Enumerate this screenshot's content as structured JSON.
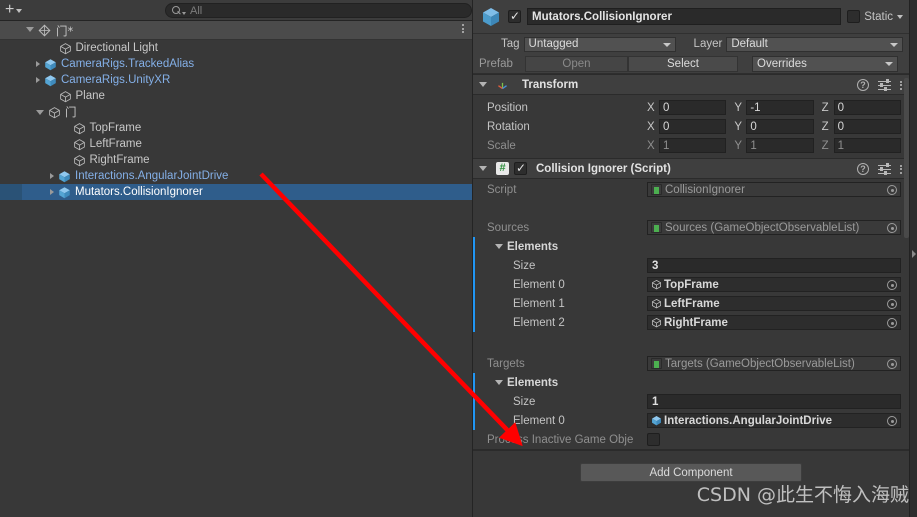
{
  "hierarchy": {
    "add_button_label": "+",
    "search": {
      "placeholder": "All",
      "icon": "search-icon"
    },
    "scene": {
      "name": "门*",
      "icon": "unity-scene-icon"
    },
    "items": [
      {
        "label": "Directional Light",
        "depth": 2,
        "twist": "none",
        "prefab": false,
        "selected": false,
        "icon": "gameobject-cube-icon"
      },
      {
        "label": "CameraRigs.TrackedAlias",
        "depth": 1,
        "twist": "closed",
        "prefab": true,
        "selected": false,
        "icon": "prefab-cube-icon"
      },
      {
        "label": "CameraRigs.UnityXR",
        "depth": 1,
        "twist": "closed",
        "prefab": true,
        "selected": false,
        "icon": "prefab-cube-icon"
      },
      {
        "label": "Plane",
        "depth": 2,
        "twist": "none",
        "prefab": false,
        "selected": false,
        "icon": "gameobject-cube-icon"
      },
      {
        "label": "门",
        "depth": 1,
        "twist": "open",
        "prefab": false,
        "selected": false,
        "icon": "gameobject-cube-icon"
      },
      {
        "label": "TopFrame",
        "depth": 3,
        "twist": "none",
        "prefab": false,
        "selected": false,
        "icon": "gameobject-cube-icon"
      },
      {
        "label": "LeftFrame",
        "depth": 3,
        "twist": "none",
        "prefab": false,
        "selected": false,
        "icon": "gameobject-cube-icon"
      },
      {
        "label": "RightFrame",
        "depth": 3,
        "twist": "none",
        "prefab": false,
        "selected": false,
        "icon": "gameobject-cube-icon"
      },
      {
        "label": "Interactions.AngularJointDrive",
        "depth": 2,
        "twist": "closed",
        "prefab": true,
        "selected": false,
        "icon": "prefab-cube-icon"
      },
      {
        "label": "Mutators.CollisionIgnorer",
        "depth": 2,
        "twist": "closed",
        "prefab": true,
        "selected": true,
        "icon": "prefab-cube-icon"
      }
    ]
  },
  "inspector": {
    "object_name": "Mutators.CollisionIgnorer",
    "enabled": true,
    "static_label": "Static",
    "tag_label": "Tag",
    "tag_value": "Untagged",
    "layer_label": "Layer",
    "layer_value": "Default",
    "prefab_label": "Prefab",
    "prefab_open": "Open",
    "prefab_select": "Select",
    "prefab_overrides": "Overrides",
    "transform": {
      "title": "Transform",
      "rows": [
        {
          "label": "Position",
          "x": "0",
          "y": "-1",
          "z": "0",
          "dim": false
        },
        {
          "label": "Rotation",
          "x": "0",
          "y": "0",
          "z": "0",
          "dim": false
        },
        {
          "label": "Scale",
          "x": "1",
          "y": "1",
          "z": "1",
          "dim": true
        }
      ],
      "axes": [
        "X",
        "Y",
        "Z"
      ]
    },
    "collision_ignorer": {
      "title": "Collision Ignorer (Script)",
      "enabled": true,
      "script_label": "Script",
      "script_value": "CollisionIgnorer",
      "sources_label": "Sources",
      "sources_value": "Sources (GameObjectObservableList)",
      "sources_elements_label": "Elements",
      "sources_size_label": "Size",
      "sources_size_value": "3",
      "sources_elements": [
        {
          "label": "Element 0",
          "value": "TopFrame"
        },
        {
          "label": "Element 1",
          "value": "LeftFrame"
        },
        {
          "label": "Element 2",
          "value": "RightFrame"
        }
      ],
      "targets_label": "Targets",
      "targets_value": "Targets (GameObjectObservableList)",
      "targets_elements_label": "Elements",
      "targets_size_label": "Size",
      "targets_size_value": "1",
      "targets_elements": [
        {
          "label": "Element 0",
          "value": "Interactions.AngularJointDrive"
        }
      ],
      "process_inactive_label": "Process Inactive Game Obje",
      "process_inactive_checked": false
    },
    "add_component_label": "Add Component"
  },
  "watermark": "CSDN @此生不悔入海贼",
  "colors": {
    "selection_blue": "#2f5d8b",
    "prefab_text_blue": "#84b0e8",
    "override_bar_blue": "#2196f3",
    "arrow_red": "#ff0000",
    "panel_bg": "#383838"
  }
}
